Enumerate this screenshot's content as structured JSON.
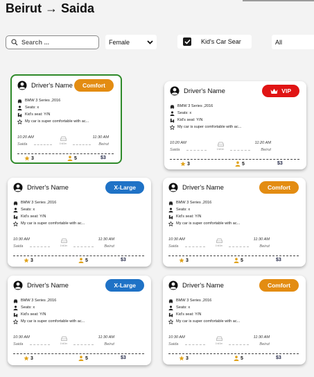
{
  "page": {
    "title": "Beirut → Saida"
  },
  "filters": {
    "search_placeholder": "Search ...",
    "gender": "Female",
    "kids_seat_label": "Kid's Car Sear",
    "kids_seat_checked": true,
    "all": "All"
  },
  "colors": {
    "comfort": "#e38c12",
    "vip": "#e01414",
    "xlarge": "#1f72c6",
    "selected_border": "#2f8a2a"
  },
  "cards": [
    {
      "driver": "Driver's Name",
      "badge": "Comfort",
      "car": "BMW 3 Series ,2016",
      "seats": "Seats: x",
      "kids_seat": "Kid's seat: Y/N",
      "note": "My car is super comfortable with ac...",
      "depart_time": "10:20 AM",
      "arrive_time": "11:30 AM",
      "from": "Saida",
      "to": "Beirut",
      "duration": "1h40m",
      "rating": "3",
      "seats_count": "5",
      "price": "$3"
    },
    {
      "driver": "Driver's Name",
      "badge": "VIP",
      "car": "BMW 3 Series ,2016",
      "seats": "Seats: x",
      "kids_seat": "Kid's seat: Y/N",
      "note": "My car is super comfortable with ac...",
      "depart_time": "10:20 AM",
      "arrive_time": "11:20 AM",
      "from": "Saida",
      "to": "Beirut",
      "duration": "1h40m",
      "rating": "3",
      "seats_count": "5",
      "price": "$3"
    },
    {
      "driver": "Driver's Name",
      "badge": "X-Large",
      "car": "BMW 3 Series ,2016",
      "seats": "Seats: x",
      "kids_seat": "Kid's seat: Y/N",
      "note": "My car is super comfortable with ac...",
      "depart_time": "10:30 AM",
      "arrive_time": "11:30 AM",
      "from": "Saida",
      "to": "Beirut",
      "duration": "1h40m",
      "rating": "3",
      "seats_count": "5",
      "price": "$3"
    },
    {
      "driver": "Driver's Name",
      "badge": "Comfort",
      "car": "BMW 3 Series ,2016",
      "seats": "Seats: x",
      "kids_seat": "Kid's seat: Y/N",
      "note": "My car is super comfortable with ac...",
      "depart_time": "10:30 AM",
      "arrive_time": "11:30 AM",
      "from": "Saida",
      "to": "Beirut",
      "duration": "1h40m",
      "rating": "3",
      "seats_count": "5",
      "price": "$3"
    },
    {
      "driver": "Driver's Name",
      "badge": "X-Large",
      "car": "BMW 3 Series ,2016",
      "seats": "Seats: x",
      "kids_seat": "Kid's seat: Y/N",
      "note": "My car is super comfortable with ac...",
      "depart_time": "10:30 AM",
      "arrive_time": "11:30 AM",
      "from": "Saida",
      "to": "Beirut",
      "duration": "1h40m",
      "rating": "3",
      "seats_count": "5",
      "price": "$3"
    },
    {
      "driver": "Driver's Name",
      "badge": "Comfort",
      "car": "BMW 3 Series ,2016",
      "seats": "Seats: x",
      "kids_seat": "Kid's seat: Y/N",
      "note": "My car is super comfortable with ac...",
      "depart_time": "10:30 AM",
      "arrive_time": "11:30 AM",
      "from": "Saida",
      "to": "Beirut",
      "duration": "1h40m",
      "rating": "3",
      "seats_count": "5",
      "price": "$3"
    }
  ]
}
